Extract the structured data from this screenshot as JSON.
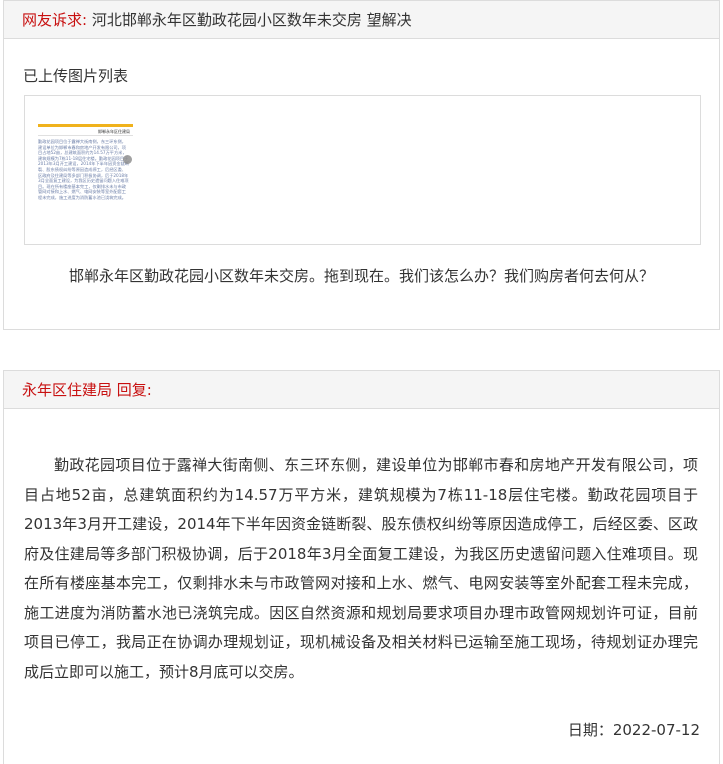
{
  "complaint": {
    "header_prefix": "网友诉求:",
    "title": "河北邯郸永年区勤政花园小区数年未交房 望解决",
    "uploaded_label": "已上传图片列表",
    "thumbnail": {
      "title": "邯郸永年区住建局",
      "text": "勤政花园项目位于露禅大街南侧，东三环东侧，建设单位为邯郸市春和房地产开发有限公司，项目占地52亩，总建筑面积约为14.57万平方米，建筑规模为7栋11-18层住宅楼。勤政花园项目于2013年3月开工建设，2014年下半年因资金链断裂、股东债权纠纷等原因造成停工，后经区委、区政府及住建局等多部门积极协调，后于2018年3月全面复工建设，为我区历史遗留问题入住难项目。现在所有楼座基本完工，仅剩排水未与市政管网对接和上水、燃气、电网安装等室外配套工程未完成，施工进度为消防蓄水池已浇筑完成。"
    },
    "text": "邯郸永年区勤政花园小区数年未交房。拖到现在。我们该怎么办？我们购房者何去何从？"
  },
  "reply": {
    "header": "永年区住建局 回复:",
    "body": "勤政花园项目位于露禅大街南侧、东三环东侧，建设单位为邯郸市春和房地产开发有限公司，项目占地52亩，总建筑面积约为14.57万平方米，建筑规模为7栋11-18层住宅楼。勤政花园项目于2013年3月开工建设，2014年下半年因资金链断裂、股东债权纠纷等原因造成停工，后经区委、区政府及住建局等多部门积极协调，后于2018年3月全面复工建设，为我区历史遗留问题入住难项目。现在所有楼座基本完工，仅剩排水未与市政管网对接和上水、燃气、电网安装等室外配套工程未完成，施工进度为消防蓄水池已浇筑完成。因区自然资源和规划局要求项目办理市政管网规划许可证，目前项目已停工，我局正在协调办理规划证，现机械设备及相关材料已运输至施工现场，待规划证办理完成后立即可以施工，预计8月底可以交房。",
    "date": "日期：2022-07-12"
  },
  "colors": {
    "accent_red": "#c81010",
    "header_bg": "#f5f5f5",
    "border": "#dcdcdc",
    "thumb_bar": "#f0b21c"
  }
}
